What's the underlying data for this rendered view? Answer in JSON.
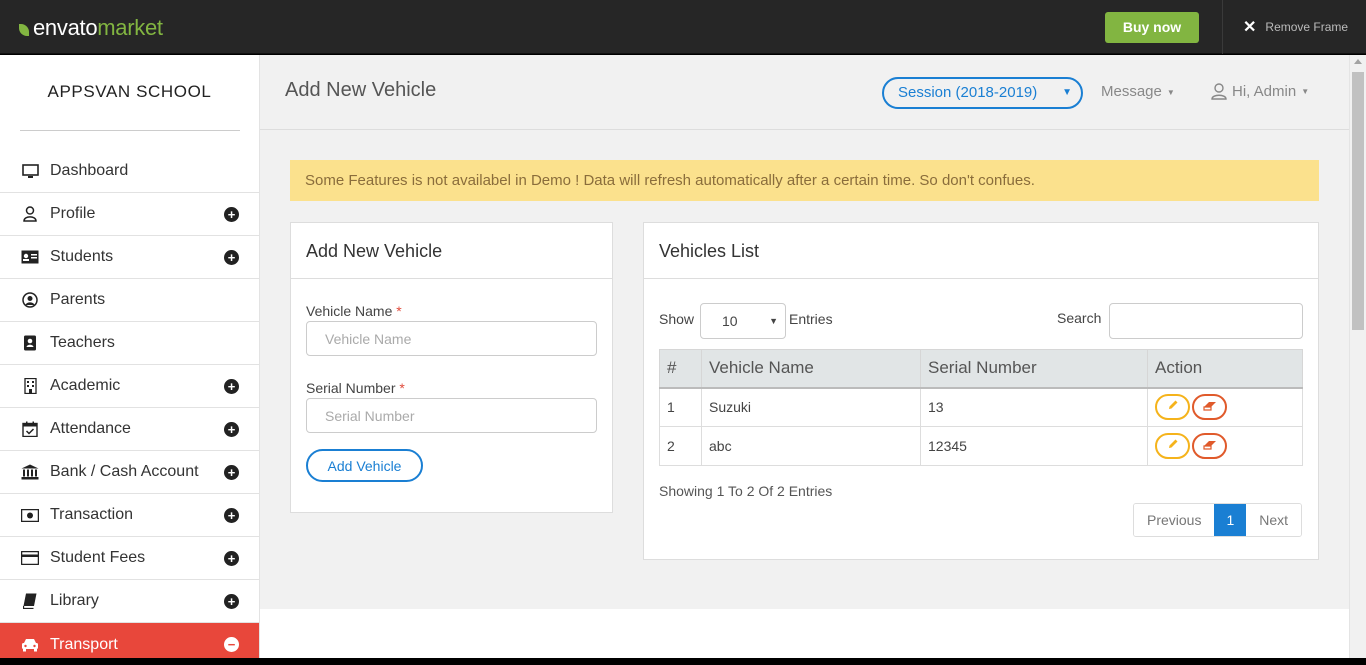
{
  "envato": {
    "logo_main": "envato",
    "logo_accent": "market",
    "buy_now": "Buy now",
    "remove_frame": "Remove Frame"
  },
  "sidebar": {
    "school_name": "APPSVAN SCHOOL",
    "items": [
      {
        "label": "Dashboard",
        "icon": "monitor-icon",
        "expandable": false
      },
      {
        "label": "Profile",
        "icon": "user-icon",
        "expandable": true
      },
      {
        "label": "Students",
        "icon": "id-card-icon",
        "expandable": true
      },
      {
        "label": "Parents",
        "icon": "user-circle-icon",
        "expandable": false
      },
      {
        "label": "Teachers",
        "icon": "contact-book-icon",
        "expandable": false
      },
      {
        "label": "Academic",
        "icon": "building-icon",
        "expandable": true
      },
      {
        "label": "Attendance",
        "icon": "calendar-check-icon",
        "expandable": true
      },
      {
        "label": "Bank / Cash Account",
        "icon": "bank-icon",
        "expandable": true
      },
      {
        "label": "Transaction",
        "icon": "money-bill-icon",
        "expandable": true
      },
      {
        "label": "Student Fees",
        "icon": "credit-card-icon",
        "expandable": true
      },
      {
        "label": "Library",
        "icon": "book-icon",
        "expandable": true
      },
      {
        "label": "Transport",
        "icon": "car-icon",
        "expandable": true,
        "active": true
      }
    ]
  },
  "header": {
    "page_title": "Add New Vehicle",
    "session": "Session (2018-2019)",
    "message": "Message",
    "user": "Hi, Admin"
  },
  "alert": {
    "text": "Some Features is not availabel in Demo ! Data will refresh automatically after a certain time. So don't confues."
  },
  "form": {
    "title": "Add New Vehicle",
    "vehicle_name_label": "Vehicle Name",
    "vehicle_name_placeholder": "Vehicle Name",
    "serial_label": "Serial Number",
    "serial_placeholder": "Serial Number",
    "required_mark": "*",
    "submit": "Add Vehicle"
  },
  "list": {
    "title": "Vehicles List",
    "show_label": "Show",
    "page_length": "10",
    "entries_label": "Entries",
    "search_label": "Search",
    "columns": [
      "#",
      "Vehicle Name",
      "Serial Number",
      "Action"
    ],
    "rows": [
      {
        "num": "1",
        "name": "Suzuki",
        "serial": "13"
      },
      {
        "num": "2",
        "name": "abc",
        "serial": "12345"
      }
    ],
    "info": "Showing 1 To 2 Of 2 Entries",
    "pager": {
      "previous": "Previous",
      "current": "1",
      "next": "Next"
    }
  },
  "colors": {
    "accent_blue": "#1a7fd3",
    "active_nav": "#e8473b",
    "envato_green": "#82b541",
    "alert_bg": "#fbe18d",
    "edit_btn": "#f5b31b",
    "delete_btn": "#e05a2b"
  }
}
